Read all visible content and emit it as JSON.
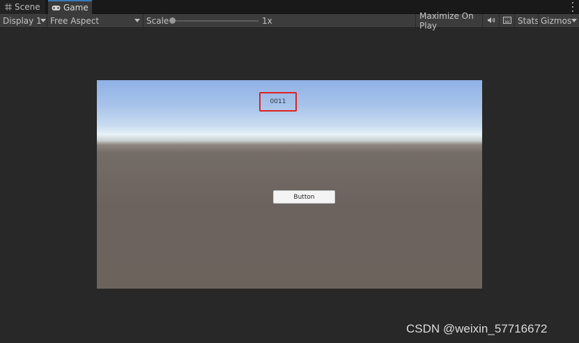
{
  "tabs": {
    "scene": "Scene",
    "game": "Game"
  },
  "toolbar": {
    "display": "Display 1",
    "aspect": "Free Aspect",
    "scale_label": "Scale",
    "scale_value": "1x",
    "maximize": "Maximize On Play",
    "stats": "Stats",
    "gizmos": "Gizmos"
  },
  "game": {
    "counter": "0011",
    "button": "Button",
    "highlight_color": "#e02020"
  },
  "watermark": "CSDN @weixin_57716672",
  "colors": {
    "accent": "#3a79bb"
  }
}
